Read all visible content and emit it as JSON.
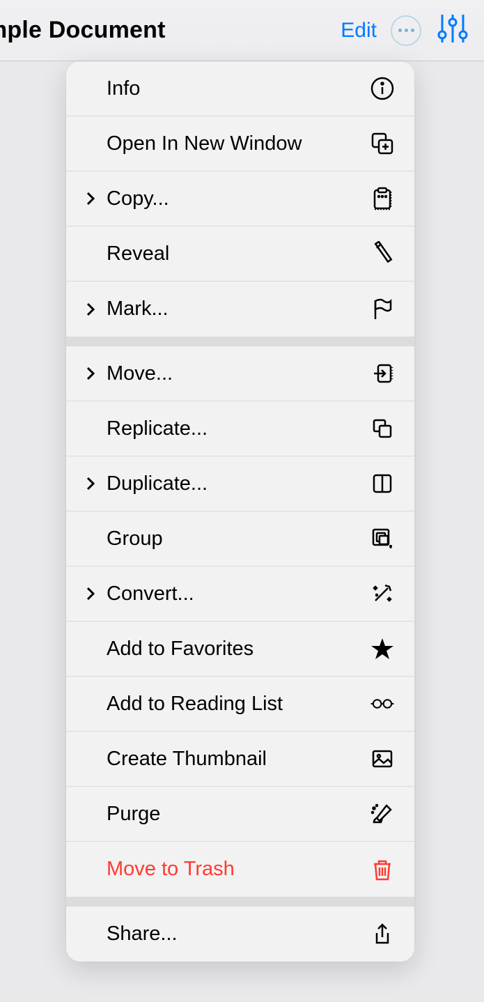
{
  "header": {
    "title": "mple Document",
    "edit": "Edit"
  },
  "menu": {
    "section1": [
      {
        "label": "Info",
        "icon": "info",
        "chevron": false
      },
      {
        "label": "Open In New Window",
        "icon": "new-window",
        "chevron": false
      },
      {
        "label": "Copy...",
        "icon": "clipboard",
        "chevron": true
      },
      {
        "label": "Reveal",
        "icon": "flashlight",
        "chevron": false
      },
      {
        "label": "Mark...",
        "icon": "flag",
        "chevron": true
      }
    ],
    "section2": [
      {
        "label": "Move...",
        "icon": "move",
        "chevron": true
      },
      {
        "label": "Replicate...",
        "icon": "replicate",
        "chevron": false
      },
      {
        "label": "Duplicate...",
        "icon": "duplicate",
        "chevron": true
      },
      {
        "label": "Group",
        "icon": "group",
        "chevron": false
      },
      {
        "label": "Convert...",
        "icon": "convert",
        "chevron": true
      },
      {
        "label": "Add to Favorites",
        "icon": "star",
        "chevron": false
      },
      {
        "label": "Add to Reading List",
        "icon": "glasses",
        "chevron": false
      },
      {
        "label": "Create Thumbnail",
        "icon": "thumbnail",
        "chevron": false
      },
      {
        "label": "Purge",
        "icon": "purge",
        "chevron": false
      },
      {
        "label": "Move to Trash",
        "icon": "trash",
        "chevron": false,
        "destructive": true
      }
    ],
    "section3": [
      {
        "label": "Share...",
        "icon": "share",
        "chevron": false
      }
    ]
  }
}
